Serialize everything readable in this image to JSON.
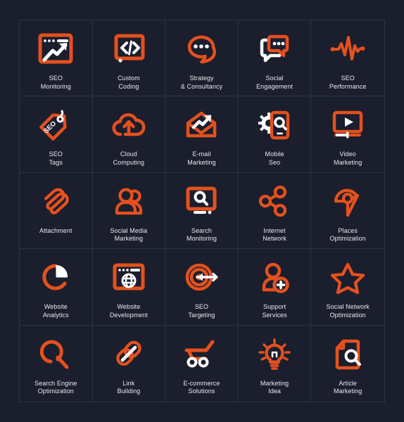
{
  "palette": {
    "background": "#1b1e2d",
    "grid_line": "#2e3346",
    "accent_orange": "#e4511e",
    "icon_white": "#ffffff",
    "label_text": "#e9eaee"
  },
  "grid": {
    "columns": 5,
    "rows": 5,
    "total_icons": 25
  },
  "icons": [
    {
      "id": "seo-monitoring",
      "icon": "browser-chart-arrow-icon",
      "label": "SEO\nMonitoring"
    },
    {
      "id": "custom-coding",
      "icon": "code-brackets-window-icon",
      "label": "Custom\nCoding"
    },
    {
      "id": "strategy-consultancy",
      "icon": "speech-bubble-dots-icon",
      "label": "Strategy\n& Consultancy"
    },
    {
      "id": "social-engagement",
      "icon": "double-chat-bubble-icon",
      "label": "Social\nEngagement"
    },
    {
      "id": "seo-performance",
      "icon": "heartbeat-pulse-icon",
      "label": "SEO\nPerformance"
    },
    {
      "id": "seo-tags",
      "icon": "price-tag-seo-icon",
      "label": "SEO\nTags"
    },
    {
      "id": "cloud-computing",
      "icon": "cloud-upload-icon",
      "label": "Cloud\nComputing"
    },
    {
      "id": "email-marketing",
      "icon": "envelope-growth-arrow-icon",
      "label": "E-mail\nMarketing"
    },
    {
      "id": "mobile-seo",
      "icon": "phone-gear-search-icon",
      "label": "Mobile\nSeo"
    },
    {
      "id": "video-marketing",
      "icon": "video-player-play-icon",
      "label": "Video\nMarketing"
    },
    {
      "id": "attachment",
      "icon": "paperclip-icon",
      "label": "Attachment"
    },
    {
      "id": "social-media-marketing",
      "icon": "two-users-icon",
      "label": "Social Media\nMarketing"
    },
    {
      "id": "search-monitoring",
      "icon": "monitor-magnifier-icon",
      "label": "Search\nMonitoring"
    },
    {
      "id": "internet-network",
      "icon": "share-nodes-icon",
      "label": "Internet\nNetwork"
    },
    {
      "id": "places-optimization",
      "icon": "map-pin-places-icon",
      "label": "Places\nOptimization"
    },
    {
      "id": "website-analytics",
      "icon": "pie-chart-icon",
      "label": "Website\nAnalytics"
    },
    {
      "id": "website-development",
      "icon": "browser-globe-icon",
      "label": "Website\nDevelopment"
    },
    {
      "id": "seo-targeting",
      "icon": "target-arrow-icon",
      "label": "SEO\nTargeting"
    },
    {
      "id": "support-services",
      "icon": "user-plus-icon",
      "label": "Support\nServices"
    },
    {
      "id": "social-network-optimization",
      "icon": "star-icon",
      "label": "Social Network\nOptimization"
    },
    {
      "id": "search-engine-optimization",
      "icon": "magnifier-icon",
      "label": "Search Engine\nOptimization"
    },
    {
      "id": "link-building",
      "icon": "chain-link-icon",
      "label": "Link\nBuilding"
    },
    {
      "id": "ecommerce-solutions",
      "icon": "shopping-cart-icon",
      "label": "E-commerce\nSolutions"
    },
    {
      "id": "marketing-idea",
      "icon": "lightbulb-icon",
      "label": "Marketing\nIdea"
    },
    {
      "id": "article-marketing",
      "icon": "document-magnifier-icon",
      "label": "Article\nMarketing"
    }
  ]
}
